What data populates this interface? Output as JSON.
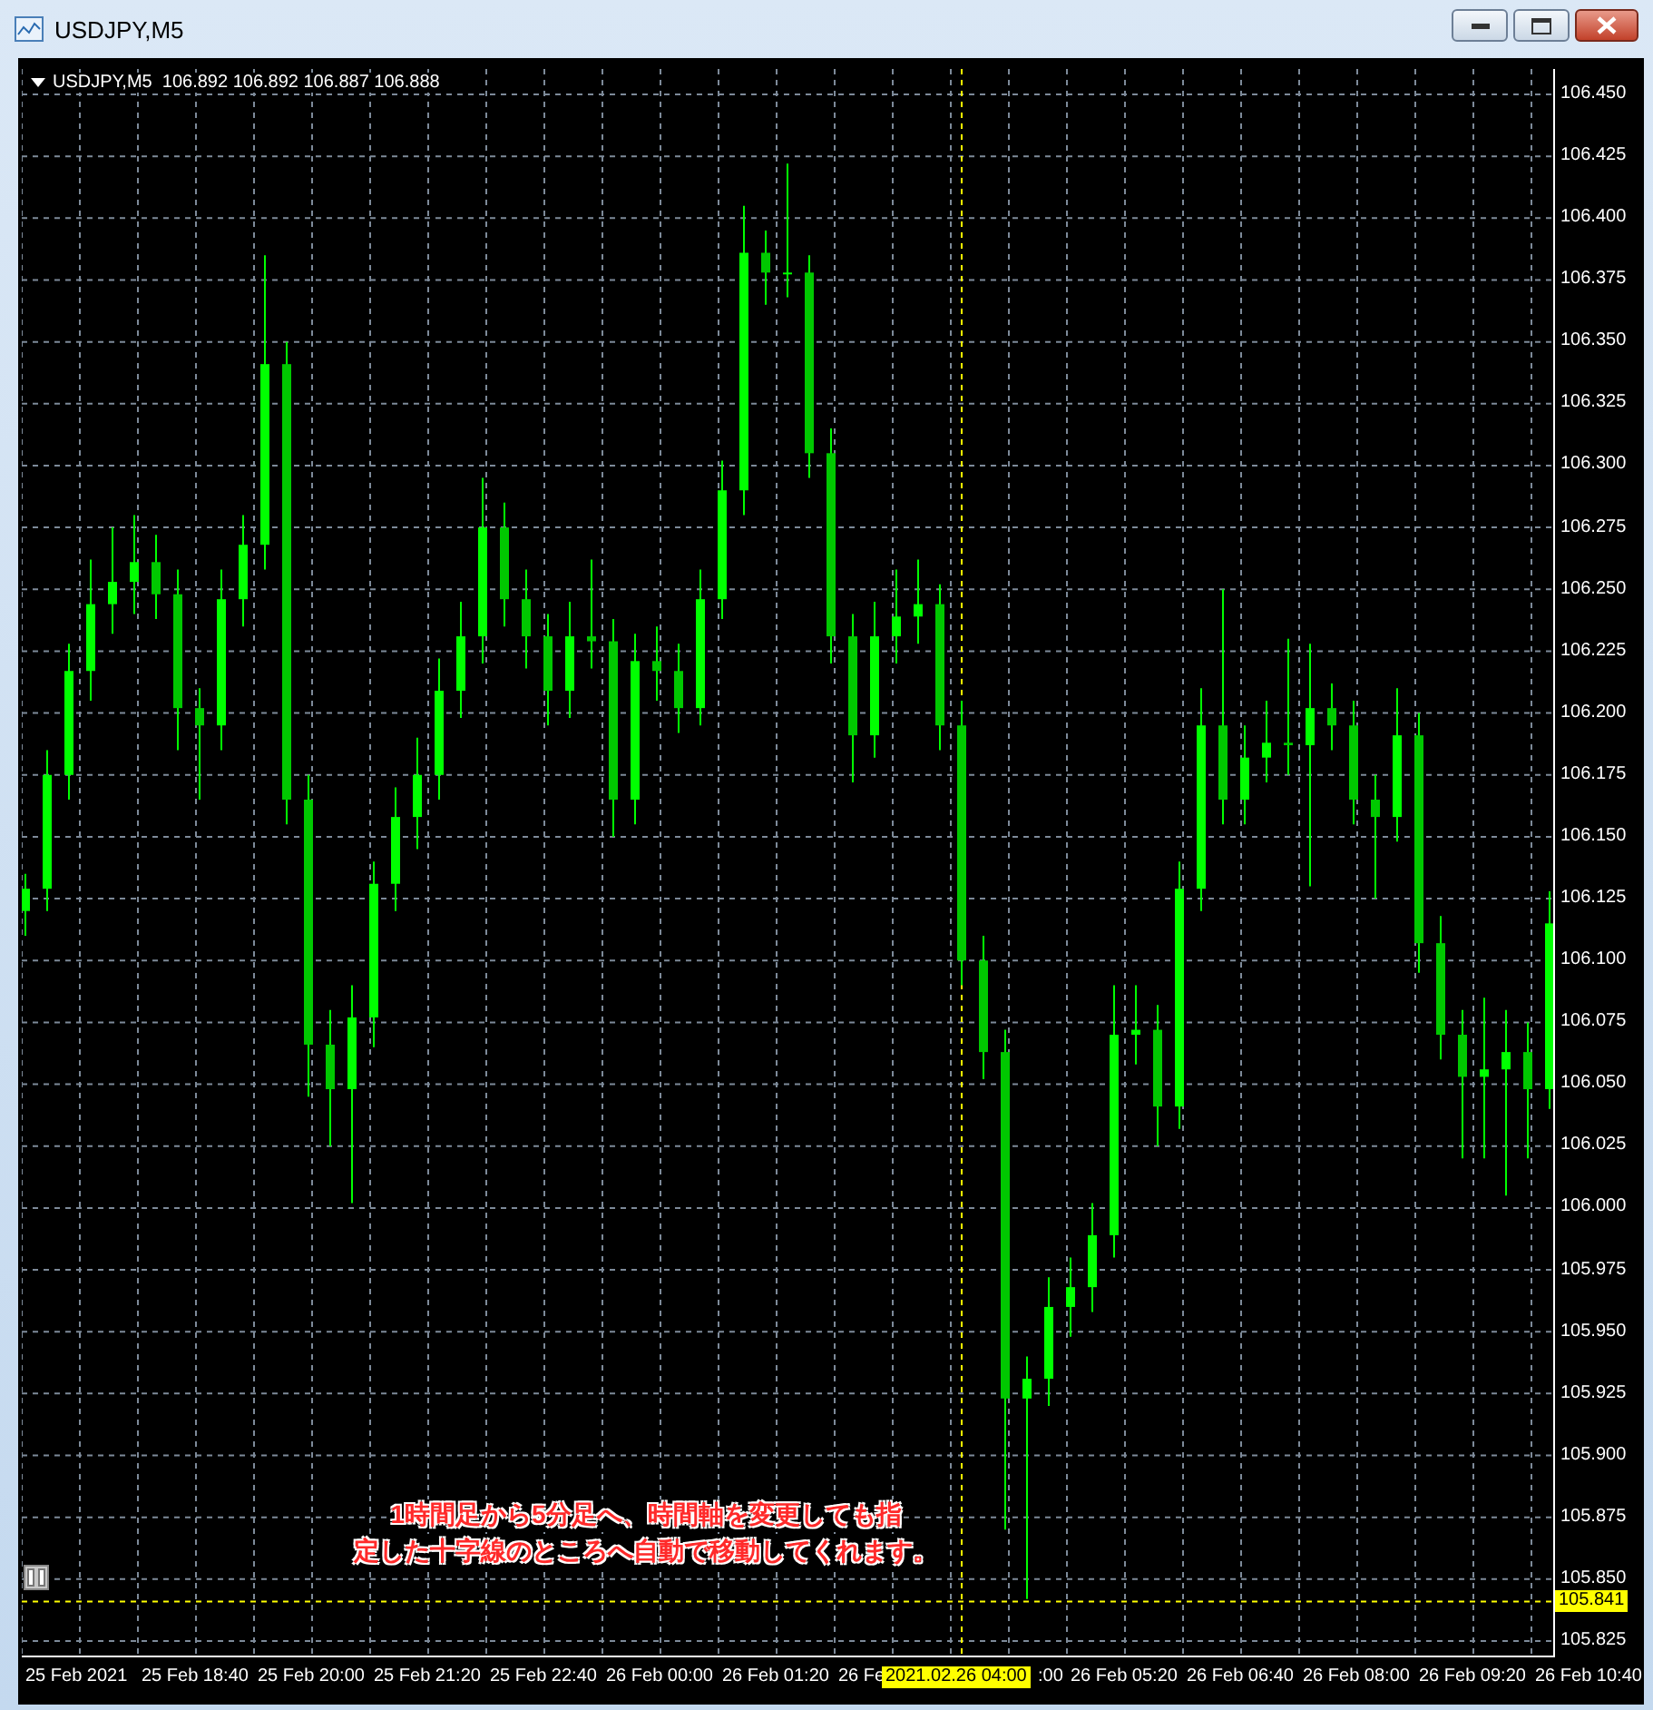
{
  "window": {
    "title": "USDJPY,M5"
  },
  "chart": {
    "header": "USDJPY,M5  106.892 106.892 106.887 106.888",
    "time_labels": [
      {
        "text": "25 Feb 2021",
        "kind": "full"
      },
      {
        "text": "25 Feb 18:40",
        "kind": "full"
      },
      {
        "text": "25 Feb 20:00",
        "kind": "full"
      },
      {
        "text": "25 Feb 21:20",
        "kind": "full"
      },
      {
        "text": "25 Feb 22:40",
        "kind": "full"
      },
      {
        "text": "26 Feb 00:00",
        "kind": "full"
      },
      {
        "text": "26 Feb 01:20",
        "kind": "full"
      },
      {
        "text": "26 Fe",
        "kind": "full"
      },
      {
        "text": ":00",
        "kind": "tail"
      },
      {
        "text": "26 Feb 05:20",
        "kind": "full"
      },
      {
        "text": "26 Feb 06:40",
        "kind": "full"
      },
      {
        "text": "26 Feb 08:00",
        "kind": "full"
      },
      {
        "text": "26 Feb 09:20",
        "kind": "full"
      },
      {
        "text": "26 Feb 10:40",
        "kind": "full"
      }
    ],
    "crosshair_time_label": "2021.02.26 04:00",
    "note_lines": [
      "1時間足から5分足へ、時間軸を変更しても指",
      "定した十字線のところへ自動で移動してくれます。"
    ],
    "chart_data": {
      "type": "candlestick",
      "ylim": [
        105.825,
        106.45
      ],
      "grid": true,
      "ref_lines": [
        {
          "axis": "y",
          "value": 105.841,
          "label": "105.841",
          "color": "#ffff00"
        }
      ],
      "yticks": [
        {
          "value": 106.45,
          "label": "106.450"
        },
        {
          "value": 106.425,
          "label": "106.425"
        },
        {
          "value": 106.4,
          "label": "106.400"
        },
        {
          "value": 106.375,
          "label": "106.375"
        },
        {
          "value": 106.35,
          "label": "106.350"
        },
        {
          "value": 106.325,
          "label": "106.325"
        },
        {
          "value": 106.3,
          "label": "106.300"
        },
        {
          "value": 106.275,
          "label": "106.275"
        },
        {
          "value": 106.25,
          "label": "106.250"
        },
        {
          "value": 106.225,
          "label": "106.225"
        },
        {
          "value": 106.2,
          "label": "106.200"
        },
        {
          "value": 106.175,
          "label": "106.175"
        },
        {
          "value": 106.15,
          "label": "106.150"
        },
        {
          "value": 106.125,
          "label": "106.125"
        },
        {
          "value": 106.1,
          "label": "106.100"
        },
        {
          "value": 106.075,
          "label": "106.075"
        },
        {
          "value": 106.05,
          "label": "106.050"
        },
        {
          "value": 106.025,
          "label": "106.025"
        },
        {
          "value": 106.0,
          "label": "106.000"
        },
        {
          "value": 105.975,
          "label": "105.975"
        },
        {
          "value": 105.95,
          "label": "105.950"
        },
        {
          "value": 105.925,
          "label": "105.925"
        },
        {
          "value": 105.9,
          "label": "105.900"
        },
        {
          "value": 105.875,
          "label": "105.875"
        },
        {
          "value": 105.85,
          "label": "105.850"
        },
        {
          "value": 105.825,
          "label": "105.825"
        }
      ],
      "categories": [
        null,
        null,
        null,
        null,
        null,
        null,
        null,
        null,
        null,
        null,
        null,
        null,
        null,
        null,
        null,
        null,
        null,
        null,
        null,
        null,
        null,
        null,
        null,
        null,
        null,
        null,
        null,
        null,
        null,
        null,
        null,
        null,
        null,
        null,
        null,
        null,
        null,
        null,
        null,
        null,
        null,
        null,
        null,
        null,
        null,
        null,
        null,
        null,
        null,
        null,
        null,
        null,
        null,
        null,
        null,
        null,
        null,
        null,
        null,
        null,
        null,
        null,
        null,
        null,
        null,
        null,
        null,
        null,
        null,
        null,
        null
      ],
      "ohlc": [
        [
          106.12,
          106.135,
          106.11,
          106.129
        ],
        [
          106.129,
          106.185,
          106.12,
          106.175
        ],
        [
          106.175,
          106.228,
          106.165,
          106.217
        ],
        [
          106.217,
          106.262,
          106.205,
          106.244
        ],
        [
          106.244,
          106.275,
          106.232,
          106.253
        ],
        [
          106.253,
          106.28,
          106.24,
          106.261
        ],
        [
          106.261,
          106.272,
          106.238,
          106.248
        ],
        [
          106.248,
          106.258,
          106.185,
          106.202
        ],
        [
          106.202,
          106.21,
          106.165,
          106.195
        ],
        [
          106.195,
          106.258,
          106.185,
          106.246
        ],
        [
          106.246,
          106.28,
          106.235,
          106.268
        ],
        [
          106.268,
          106.385,
          106.258,
          106.341
        ],
        [
          106.341,
          106.35,
          106.155,
          106.165
        ],
        [
          106.165,
          106.175,
          106.045,
          106.066
        ],
        [
          106.066,
          106.08,
          106.025,
          106.048
        ],
        [
          106.048,
          106.09,
          106.002,
          106.077
        ],
        [
          106.077,
          106.14,
          106.065,
          106.131
        ],
        [
          106.131,
          106.17,
          106.12,
          106.158
        ],
        [
          106.158,
          106.19,
          106.145,
          106.175
        ],
        [
          106.175,
          106.222,
          106.165,
          106.209
        ],
        [
          106.209,
          106.245,
          106.198,
          106.231
        ],
        [
          106.231,
          106.295,
          106.22,
          106.275
        ],
        [
          106.275,
          106.285,
          106.235,
          106.246
        ],
        [
          106.246,
          106.258,
          106.218,
          106.231
        ],
        [
          106.231,
          106.24,
          106.195,
          106.209
        ],
        [
          106.209,
          106.245,
          106.198,
          106.231
        ],
        [
          106.231,
          106.262,
          106.218,
          106.229
        ],
        [
          106.229,
          106.238,
          106.15,
          106.165
        ],
        [
          106.165,
          106.232,
          106.155,
          106.221
        ],
        [
          106.221,
          106.235,
          106.205,
          106.217
        ],
        [
          106.217,
          106.228,
          106.192,
          106.202
        ],
        [
          106.202,
          106.258,
          106.195,
          106.246
        ],
        [
          106.246,
          106.302,
          106.238,
          106.29
        ],
        [
          106.29,
          106.405,
          106.28,
          106.386
        ],
        [
          106.386,
          106.395,
          106.365,
          106.378
        ],
        [
          106.378,
          106.422,
          106.368,
          106.378
        ],
        [
          106.378,
          106.385,
          106.295,
          106.305
        ],
        [
          106.305,
          106.315,
          106.22,
          106.231
        ],
        [
          106.231,
          106.24,
          106.172,
          106.191
        ],
        [
          106.191,
          106.245,
          106.182,
          106.231
        ],
        [
          106.231,
          106.258,
          106.22,
          106.239
        ],
        [
          106.239,
          106.262,
          106.228,
          106.244
        ],
        [
          106.244,
          106.252,
          106.185,
          106.195
        ],
        [
          106.195,
          106.205,
          106.09,
          106.1
        ],
        [
          106.1,
          106.11,
          106.052,
          106.063
        ],
        [
          106.063,
          106.072,
          105.87,
          105.923
        ],
        [
          105.923,
          105.94,
          105.842,
          105.931
        ],
        [
          105.931,
          105.972,
          105.92,
          105.96
        ],
        [
          105.96,
          105.98,
          105.948,
          105.968
        ],
        [
          105.968,
          106.002,
          105.958,
          105.989
        ],
        [
          105.989,
          106.09,
          105.98,
          106.07
        ],
        [
          106.07,
          106.09,
          106.058,
          106.072
        ],
        [
          106.072,
          106.082,
          106.025,
          106.041
        ],
        [
          106.041,
          106.14,
          106.032,
          106.129
        ],
        [
          106.129,
          106.21,
          106.12,
          106.195
        ],
        [
          106.195,
          106.25,
          106.155,
          106.165
        ],
        [
          106.165,
          106.195,
          106.155,
          106.182
        ],
        [
          106.182,
          106.205,
          106.172,
          106.188
        ],
        [
          106.188,
          106.23,
          106.175,
          106.187
        ],
        [
          106.187,
          106.228,
          106.13,
          106.202
        ],
        [
          106.202,
          106.212,
          106.185,
          106.195
        ],
        [
          106.195,
          106.205,
          106.155,
          106.165
        ],
        [
          106.165,
          106.175,
          106.125,
          106.158
        ],
        [
          106.158,
          106.21,
          106.148,
          106.191
        ],
        [
          106.191,
          106.2,
          106.095,
          106.107
        ],
        [
          106.107,
          106.118,
          106.06,
          106.07
        ],
        [
          106.07,
          106.08,
          106.02,
          106.053
        ],
        [
          106.053,
          106.085,
          106.02,
          106.056
        ],
        [
          106.056,
          106.08,
          106.005,
          106.063
        ],
        [
          106.063,
          106.075,
          106.02,
          106.048
        ],
        [
          106.048,
          106.128,
          106.04,
          106.115
        ]
      ]
    }
  }
}
